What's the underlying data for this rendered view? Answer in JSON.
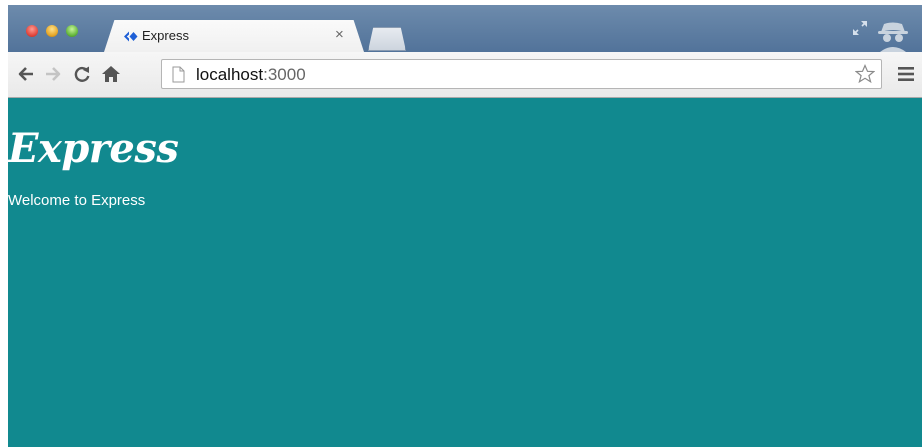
{
  "browser": {
    "tab": {
      "title": "Express",
      "close_glyph": "×",
      "favicon": "express-favicon-icon"
    },
    "address_bar": {
      "host": "localhost",
      "port": ":3000"
    },
    "icons": {
      "back": "back-arrow-icon",
      "forward": "forward-arrow-icon",
      "reload": "reload-icon",
      "home": "home-icon",
      "bookmark": "star-icon",
      "menu": "menu-icon",
      "incognito": "incognito-icon",
      "fullscreen": "fullscreen-icon"
    },
    "colors": {
      "page_background": "#11898f",
      "titlebar": "#5f7fa4"
    }
  },
  "page": {
    "heading": "Express",
    "welcome": "Welcome to Express"
  }
}
